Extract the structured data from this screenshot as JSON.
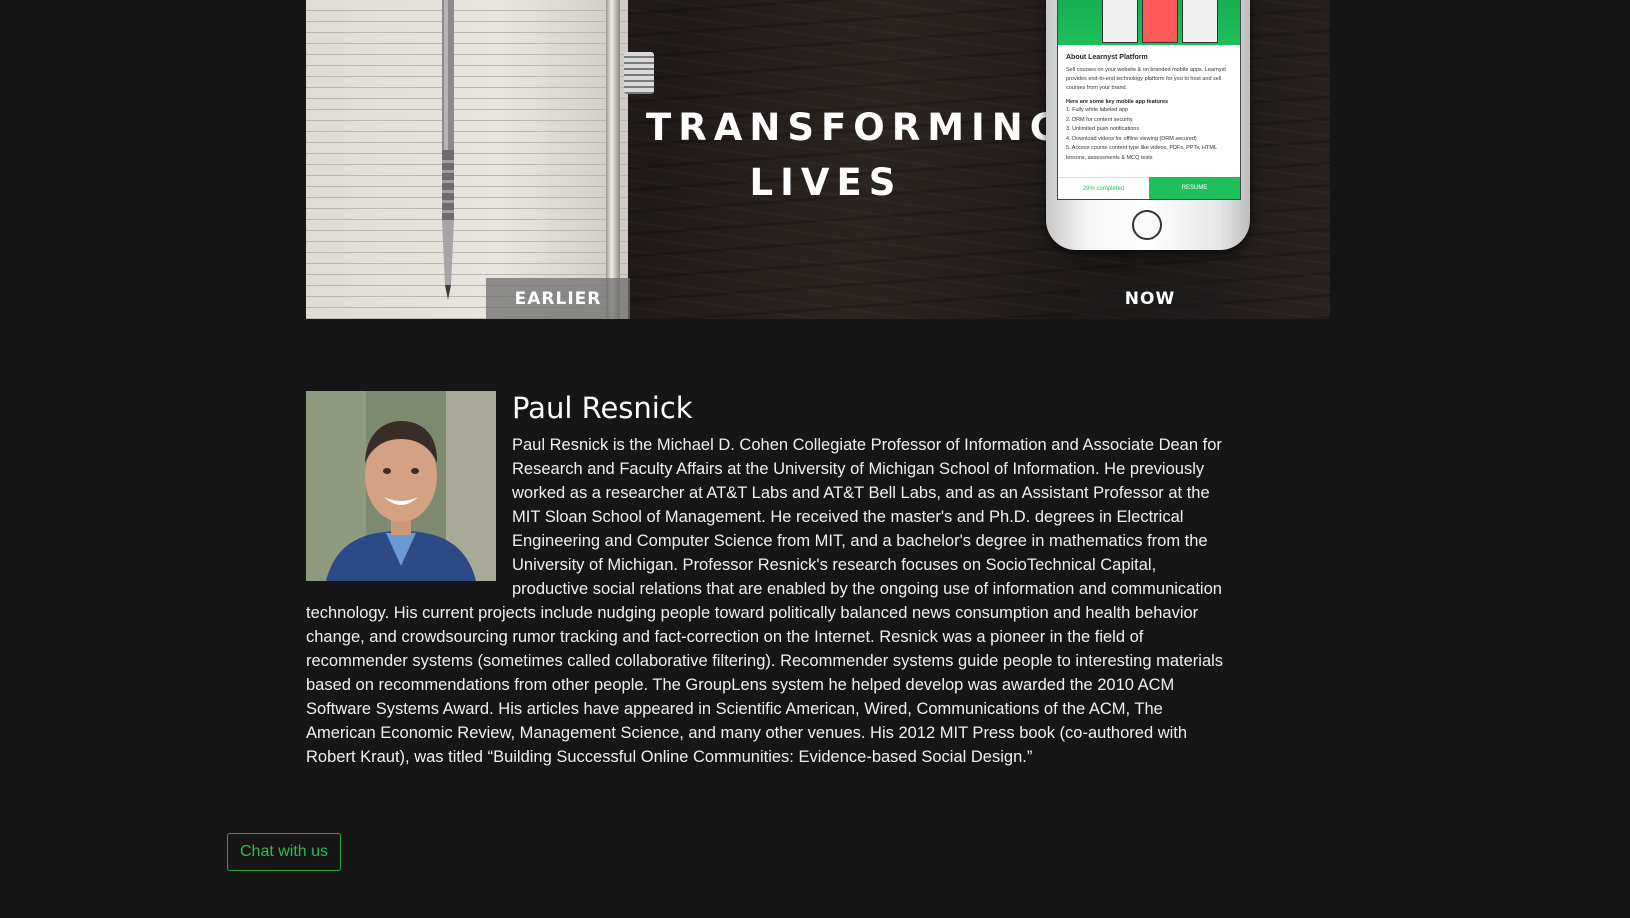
{
  "hero": {
    "title_line1": "TRANSFORMING",
    "title_line2": "LIVES",
    "label_earlier": "EARLIER",
    "label_now": "NOW",
    "phone_screen": {
      "about_title": "About Learnyst Platform",
      "about_text": "Sell courses on your website & on branded mobile apps. Learnyst provides end-to-end technology platform for you to host and sell courses from your brand.",
      "features_title": "Here are some key mobile app features",
      "features": [
        "1. Fully white labeled app",
        "2. DRM for content security",
        "3. Unlimited push notifications",
        "4. Download videos for offline viewing (DRM secured)",
        "5. Access course content type like videos, PDFs, PPTs, HTML lessons, assessments & MCQ tests"
      ],
      "progress_label": "29% completed",
      "progress_value": 0.29,
      "resume_label": "RESUME"
    }
  },
  "profile": {
    "name": "Paul Resnick",
    "bio": "Paul Resnick is the Michael D. Cohen Collegiate Professor of Information and Associate Dean for Research and Faculty Affairs at the University of Michigan School of Information. He previously worked as a researcher at AT&T Labs and AT&T Bell Labs, and as an Assistant Professor at the MIT Sloan School of Management. He received the master's and Ph.D. degrees in Electrical Engineering and Computer Science from MIT, and a bachelor's degree in mathematics from the University of Michigan. Professor Resnick's research focuses on SocioTechnical Capital, productive social relations that are enabled by the ongoing use of information and communication technology. His current projects include nudging people toward politically balanced news consumption and health behavior change, and crowdsourcing rumor tracking and fact-correction on the Internet. Resnick was a pioneer in the field of recommender systems (sometimes called collaborative filtering). Recommender systems guide people to interesting materials based on recommendations from other people. The GroupLens system he helped develop was awarded the 2010 ACM Software Systems Award. His articles have appeared in Scientific American, Wired, Communications of the ACM, The American Economic Review, Management Science, and many other venues. His 2012 MIT Press book (co-authored with Robert Kraut), was titled “Building Successful Online Communities: Evidence-based Social Design.”"
  },
  "chat": {
    "label": "Chat with us"
  },
  "colors": {
    "background": "#161616",
    "accent_green": "#28a745",
    "text": "#f0f0f0"
  }
}
